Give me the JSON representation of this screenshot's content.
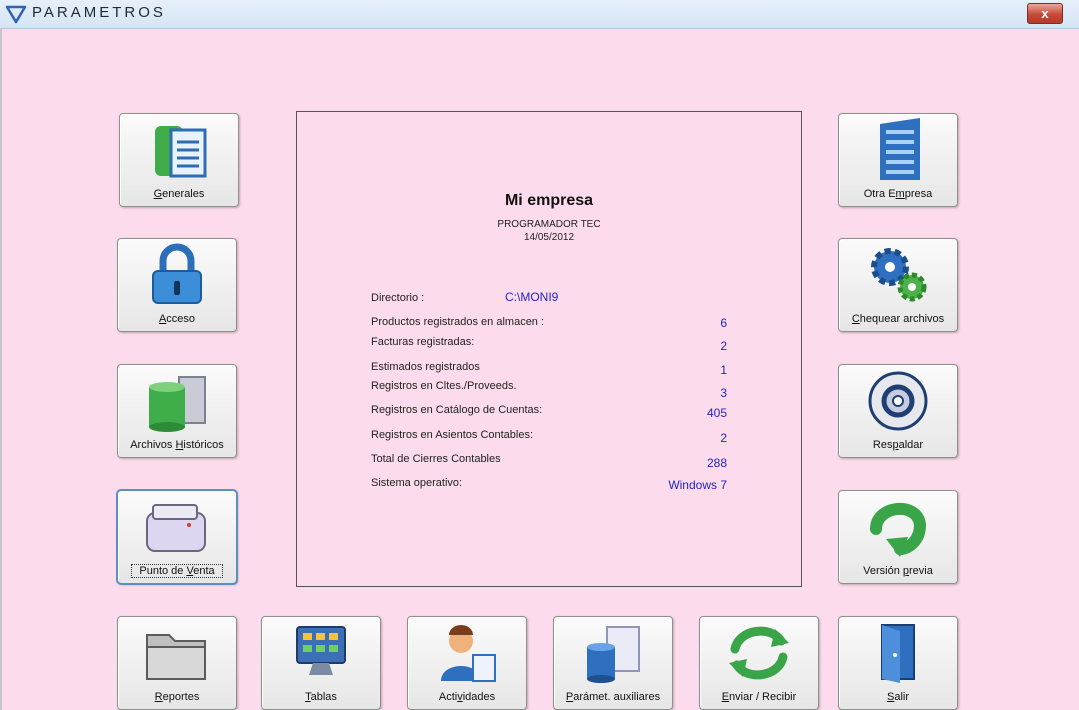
{
  "window": {
    "title": "PARAMETROS",
    "close_label": "x"
  },
  "buttons": {
    "generales": {
      "pre": "",
      "key": "G",
      "post": "enerales"
    },
    "acceso": {
      "pre": "",
      "key": "A",
      "post": "cceso"
    },
    "historicos": {
      "pre": "Archivos ",
      "key": "H",
      "post": "istóricos"
    },
    "punto_venta": {
      "pre": "Punto de ",
      "key": "V",
      "post": "enta"
    },
    "otra_empresa": {
      "pre": "Otra  E",
      "key": "m",
      "post": "presa"
    },
    "chequear": {
      "pre": "",
      "key": "C",
      "post": "hequear archivos"
    },
    "respaldar": {
      "pre": "Res",
      "key": "p",
      "post": "aldar"
    },
    "version": {
      "pre": "Versión ",
      "key": "p",
      "post": "revia"
    },
    "reportes": {
      "pre": "",
      "key": "R",
      "post": "eportes"
    },
    "tablas": {
      "pre": "",
      "key": "T",
      "post": "ablas"
    },
    "actividades": {
      "pre": "Acti",
      "key": "v",
      "post": "idades"
    },
    "parametros_aux": {
      "pre": "",
      "key": "P",
      "post": "arámet. auxiliares"
    },
    "enviar": {
      "pre": "",
      "key": "E",
      "post": "nviar / Recibir"
    },
    "salir": {
      "pre": "",
      "key": "S",
      "post": "alir"
    }
  },
  "info": {
    "company": "Mi empresa",
    "user": "PROGRAMADOR TEC",
    "date": "14/05/2012",
    "rows": [
      {
        "label": "Directorio :",
        "value": "C:\\MONI9"
      },
      {
        "label": "Productos registrados en almacen :",
        "value": "6"
      },
      {
        "label": "Facturas registradas:",
        "value": "2"
      },
      {
        "label": "Estimados registrados",
        "value": "1"
      },
      {
        "label": "Registros en Cltes./Proveeds.",
        "value": "3"
      },
      {
        "label": "Registros en Catálogo de Cuentas:",
        "value": "405"
      },
      {
        "label": "Registros en Asientos Contables:",
        "value": "2"
      },
      {
        "label": "Total de Cierres Contables",
        "value": "288"
      },
      {
        "label": "Sistema operativo:",
        "value": "Windows 7"
      }
    ]
  },
  "colors": {
    "background": "#fcdcec",
    "value_text": "#2323c8",
    "close_button": "#c74a37"
  },
  "icons": {
    "generales": "document-icon",
    "acceso": "padlock-icon",
    "historicos": "archive-server-icon",
    "punto_venta": "printer-icon",
    "otra_empresa": "office-building-icon",
    "chequear": "gears-icon",
    "respaldar": "disc-icon",
    "version": "back-arrow-icon",
    "reportes": "folder-icon",
    "tablas": "monitor-icon",
    "actividades": "user-icon",
    "parametros_aux": "database-grid-icon",
    "enviar": "sync-arrows-icon",
    "salir": "exit-door-icon"
  }
}
